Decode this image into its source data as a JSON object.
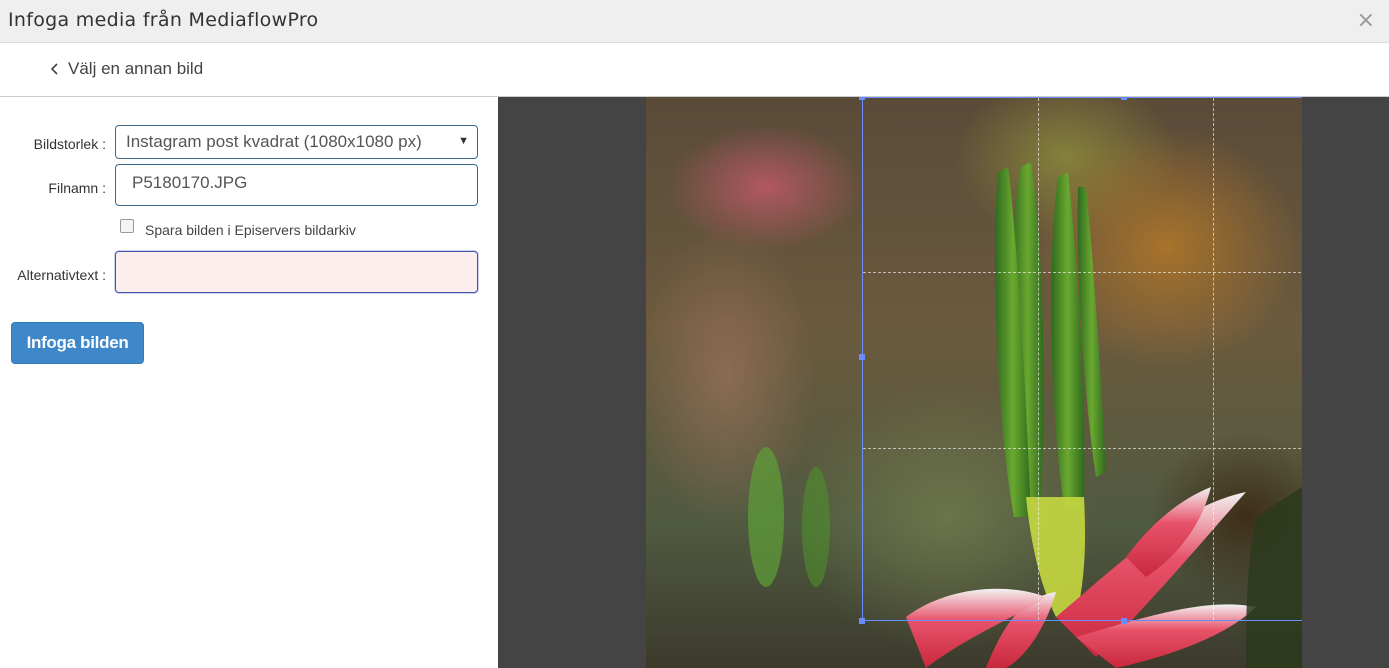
{
  "dialog": {
    "title": "Infoga media från MediaflowPro",
    "close_icon": "×"
  },
  "toolbar": {
    "back_label": "Välj en annan bild"
  },
  "form": {
    "size_label": "Bildstorlek :",
    "size_value": "Instagram post kvadrat (1080x1080 px)",
    "filename_label": "Filnamn :",
    "filename_value": "P5180170.JPG",
    "save_checkbox_label": "Spara bilden i Episervers bildarkiv",
    "save_checked": false,
    "alt_label": "Alternativtext :",
    "alt_value": "",
    "insert_button": "Infoga bilden"
  },
  "colors": {
    "primary_button": "#3e87c9",
    "crop_border": "#6a8cff",
    "preview_background": "#444444"
  }
}
